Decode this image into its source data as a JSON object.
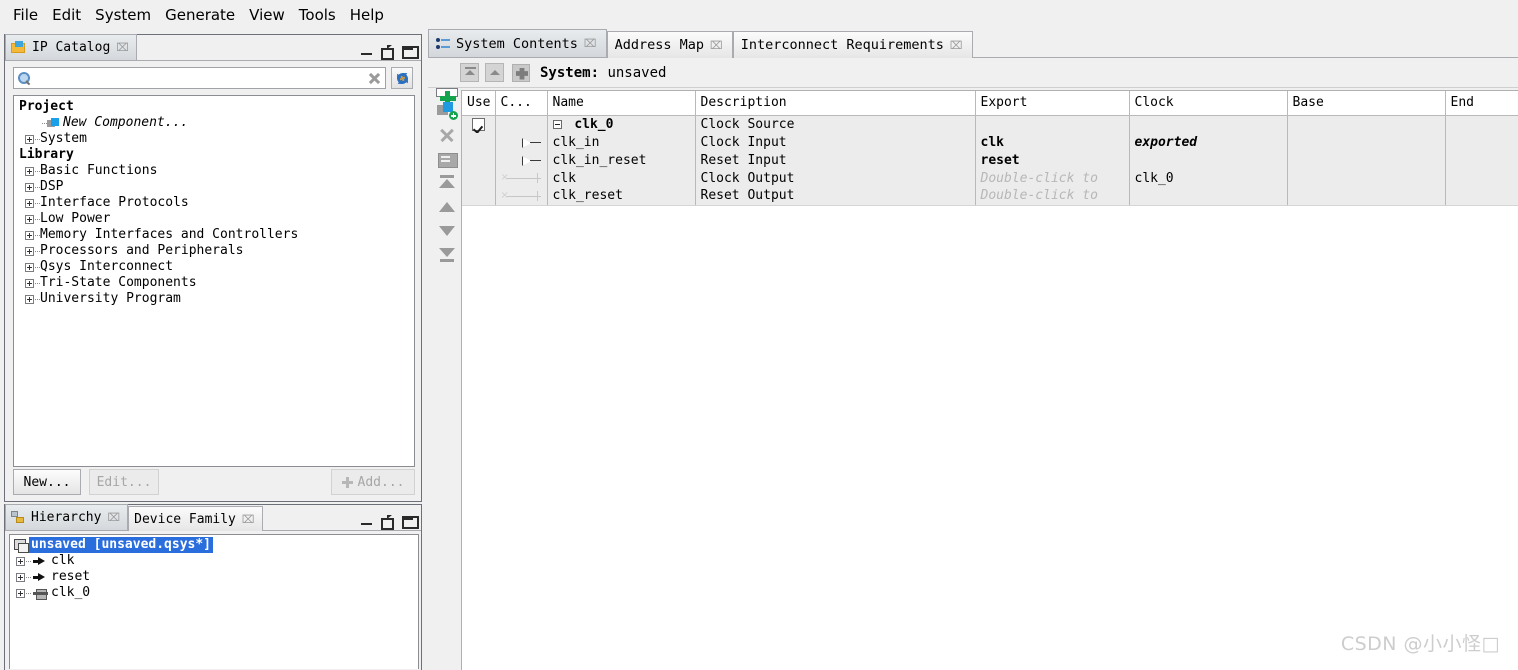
{
  "menubar": {
    "items": [
      {
        "label": "File"
      },
      {
        "label": "Edit"
      },
      {
        "label": "System"
      },
      {
        "label": "Generate"
      },
      {
        "label": "View"
      },
      {
        "label": "Tools"
      },
      {
        "label": "Help"
      }
    ]
  },
  "colors": {
    "selection_blue": "#2a6ddd",
    "row_gray": "#ececec",
    "add_green": "#14a44d",
    "component_blue": "#1f9ae0",
    "panel_bg": "#f0f0f0",
    "ghost_text": "#b7b7b7",
    "watermark": "#cdcdcd"
  },
  "ip_catalog": {
    "tab": {
      "label": "IP Catalog",
      "icon": "folder-icon",
      "close": "⌧"
    },
    "window_buttons": [
      "minimize-icon",
      "restore-icon",
      "maximize-icon"
    ],
    "search": {
      "value": "",
      "placeholder": "",
      "icon": "search-icon",
      "clear_icon": "clear-icon"
    },
    "settings_button": {
      "icon": "gear-icon"
    },
    "tree": [
      {
        "label": "Project",
        "type": "header",
        "indent": 0
      },
      {
        "label": "New Component...",
        "type": "leaf-italic",
        "indent": 2,
        "icon": "component-icon"
      },
      {
        "label": "System",
        "type": "expandable",
        "indent": 1
      },
      {
        "label": "Library",
        "type": "header",
        "indent": 0
      },
      {
        "label": "Basic Functions",
        "type": "expandable",
        "indent": 1
      },
      {
        "label": "DSP",
        "type": "expandable",
        "indent": 1
      },
      {
        "label": "Interface Protocols",
        "type": "expandable",
        "indent": 1
      },
      {
        "label": "Low Power",
        "type": "expandable",
        "indent": 1
      },
      {
        "label": "Memory Interfaces and Controllers",
        "type": "expandable",
        "indent": 1
      },
      {
        "label": "Processors and Peripherals",
        "type": "expandable",
        "indent": 1
      },
      {
        "label": "Qsys Interconnect",
        "type": "expandable",
        "indent": 1
      },
      {
        "label": "Tri-State Components",
        "type": "expandable",
        "indent": 1
      },
      {
        "label": "University Program",
        "type": "expandable",
        "indent": 1
      }
    ],
    "buttons": {
      "new": {
        "label": "New...",
        "enabled": true
      },
      "edit": {
        "label": "Edit...",
        "enabled": false
      },
      "add": {
        "label": "Add...",
        "enabled": false,
        "icon": "plus-icon"
      }
    }
  },
  "hierarchy_panel": {
    "tabs": [
      {
        "label": "Hierarchy",
        "active": true,
        "icon": "hierarchy-icon",
        "close": "⌧"
      },
      {
        "label": "Device Family",
        "active": false,
        "close": "⌧"
      }
    ],
    "window_buttons": [
      "minimize-icon",
      "restore-icon",
      "maximize-icon"
    ],
    "tree": [
      {
        "label": "unsaved [unsaved.qsys*]",
        "selected": true,
        "icon": "system-icon",
        "indent": 0
      },
      {
        "label": "clk",
        "selected": false,
        "icon": "port-icon",
        "indent": 1,
        "expandable": true
      },
      {
        "label": "reset",
        "selected": false,
        "icon": "port-icon",
        "indent": 1,
        "expandable": true
      },
      {
        "label": "clk_0",
        "selected": false,
        "icon": "module-icon",
        "indent": 1,
        "expandable": true
      }
    ]
  },
  "system_contents": {
    "tabs": [
      {
        "label": "System Contents",
        "active": true,
        "icon": "system-contents-icon",
        "close": "⌧"
      },
      {
        "label": "Address Map",
        "active": false,
        "close": "⌧"
      },
      {
        "label": "Interconnect Requirements",
        "active": false,
        "close": "⌧"
      }
    ],
    "toolbar": {
      "collapse_all_icon": "collapse-all-icon",
      "collapse_one_icon": "collapse-one-icon",
      "system_icon": "system-glyph-icon",
      "label_prefix": "System:",
      "system_name": "unsaved"
    },
    "action_tools": [
      {
        "name": "add-icon"
      },
      {
        "name": "add-component-icon"
      },
      {
        "name": "remove-icon"
      },
      {
        "name": "edit-icon"
      },
      {
        "name": "move-to-top-icon"
      },
      {
        "name": "move-up-icon"
      },
      {
        "name": "move-down-icon"
      },
      {
        "name": "move-to-bottom-icon"
      }
    ],
    "columns": [
      "Use",
      "C...",
      "Name",
      "Description",
      "Export",
      "Clock",
      "Base",
      "End"
    ],
    "rows": [
      {
        "use": true,
        "conn": "none",
        "name": "clk_0",
        "name_style": "bold-group",
        "description": "Clock Source",
        "export": "",
        "export_style": "",
        "clock": "",
        "clock_style": "",
        "base": "",
        "end": ""
      },
      {
        "use": null,
        "conn": "port-out",
        "name": "clk_in",
        "name_style": "child",
        "description": "Clock Input",
        "export": "clk",
        "export_style": "bold",
        "clock": "exported",
        "clock_style": "bold-italic",
        "base": "",
        "end": ""
      },
      {
        "use": null,
        "conn": "port-out",
        "name": "clk_in_reset",
        "name_style": "child",
        "description": "Reset Input",
        "export": "reset",
        "export_style": "bold",
        "clock": "",
        "clock_style": "",
        "base": "",
        "end": ""
      },
      {
        "use": null,
        "conn": "line",
        "name": "clk",
        "name_style": "child",
        "description": "Clock Output",
        "export": "Double-click to",
        "export_style": "ghost",
        "clock": "clk_0",
        "clock_style": "",
        "base": "",
        "end": ""
      },
      {
        "use": null,
        "conn": "line",
        "name": "clk_reset",
        "name_style": "child",
        "description": "Reset Output",
        "export": "Double-click to",
        "export_style": "ghost",
        "clock": "",
        "clock_style": "",
        "base": "",
        "end": ""
      }
    ]
  },
  "watermark": {
    "text": "CSDN @小小怪□"
  }
}
